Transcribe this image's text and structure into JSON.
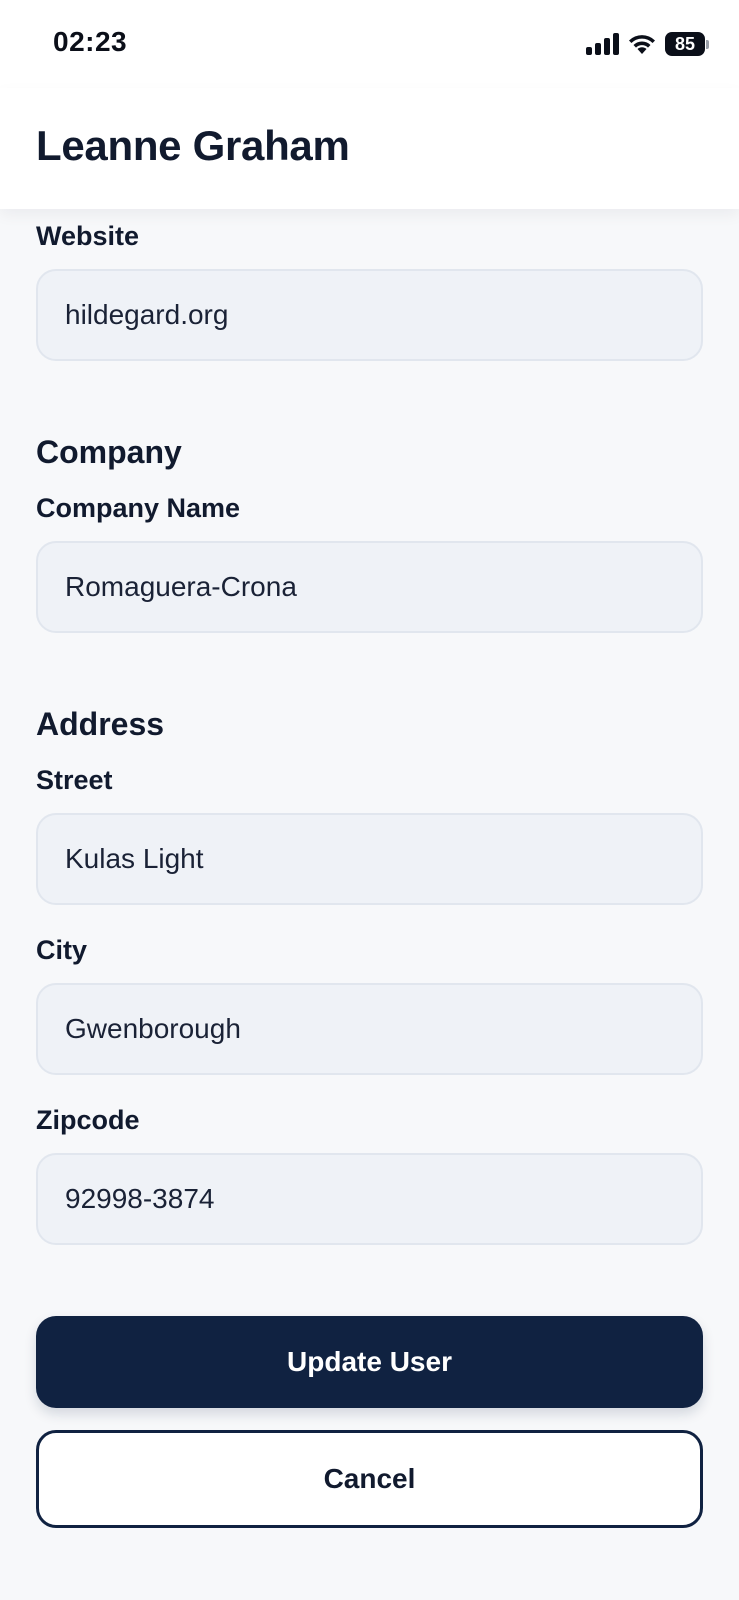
{
  "status_bar": {
    "time": "02:23",
    "battery": "85"
  },
  "header": {
    "title": "Leanne Graham"
  },
  "form": {
    "website": {
      "label": "Website",
      "value": "hildegard.org"
    },
    "company_section": "Company",
    "company_name": {
      "label": "Company Name",
      "value": "Romaguera-Crona"
    },
    "address_section": "Address",
    "street": {
      "label": "Street",
      "value": "Kulas Light"
    },
    "city": {
      "label": "City",
      "value": "Gwenborough"
    },
    "zipcode": {
      "label": "Zipcode",
      "value": "92998-3874"
    }
  },
  "actions": {
    "update_label": "Update User",
    "cancel_label": "Cancel"
  },
  "colors": {
    "primary": "#102241",
    "background": "#f7f8fa",
    "input_background": "#eff2f7"
  }
}
